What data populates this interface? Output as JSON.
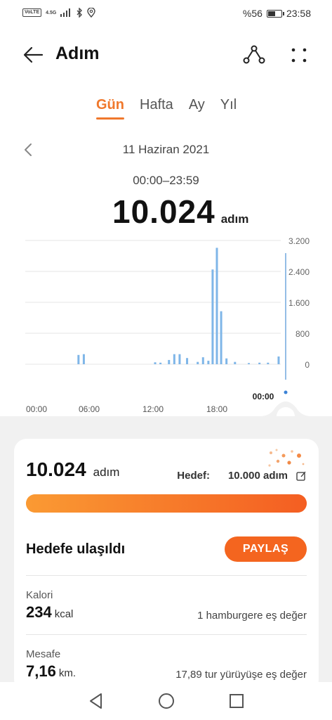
{
  "status_bar": {
    "volte": "VoLTE",
    "network": "4.5G",
    "battery": "%56",
    "battery_level": 0.56,
    "time": "23:58"
  },
  "app_bar": {
    "title": "Adım",
    "back_icon": "arrow-left-icon",
    "route_icon": "route-share-icon",
    "more_icon": "more-dots-icon"
  },
  "tabs": [
    {
      "label": "Gün",
      "active": true
    },
    {
      "label": "Hafta",
      "active": false
    },
    {
      "label": "Ay",
      "active": false
    },
    {
      "label": "Yıl",
      "active": false
    }
  ],
  "date": "11 Haziran 2021",
  "time_range": "00:00–23:59",
  "total_steps": "10.024",
  "steps_unit": "adım",
  "chart_data": {
    "type": "bar",
    "x_ticks": [
      "00:00",
      "06:00",
      "12:00",
      "18:00"
    ],
    "y_ticks": [
      "3.200",
      "2.400",
      "1.600",
      "800",
      "0"
    ],
    "ylim": [
      0,
      3200
    ],
    "cursor_label": "00:00",
    "bars": [
      {
        "hour": 5.0,
        "value": 240
      },
      {
        "hour": 5.5,
        "value": 260
      },
      {
        "hour": 12.2,
        "value": 50
      },
      {
        "hour": 12.7,
        "value": 40
      },
      {
        "hour": 13.5,
        "value": 110
      },
      {
        "hour": 14.0,
        "value": 260
      },
      {
        "hour": 14.5,
        "value": 260
      },
      {
        "hour": 15.2,
        "value": 160
      },
      {
        "hour": 16.2,
        "value": 60
      },
      {
        "hour": 16.7,
        "value": 180
      },
      {
        "hour": 17.2,
        "value": 90
      },
      {
        "hour": 17.6,
        "value": 2450
      },
      {
        "hour": 18.0,
        "value": 3010
      },
      {
        "hour": 18.4,
        "value": 1370
      },
      {
        "hour": 18.9,
        "value": 150
      },
      {
        "hour": 19.7,
        "value": 60
      },
      {
        "hour": 21.0,
        "value": 30
      },
      {
        "hour": 22.0,
        "value": 40
      },
      {
        "hour": 22.8,
        "value": 40
      },
      {
        "hour": 23.8,
        "value": 200
      }
    ]
  },
  "summary": {
    "steps": "10.024",
    "steps_unit": "adım",
    "goal_label": "Hedef:",
    "goal_value": "10.000 adım",
    "progress": 1.0,
    "goal_reached": "Hedefe ulaşıldı",
    "share_label": "PAYLAŞ"
  },
  "stats": [
    {
      "label": "Kalori",
      "value": "234",
      "unit": "kcal",
      "equivalent": "1 hamburgere eş değer"
    },
    {
      "label": "Mesafe",
      "value": "7,16",
      "unit": "km.",
      "equivalent": "17,89 tur yürüyüşe eş değer"
    }
  ],
  "colors": {
    "accent": "#f0782c",
    "bar": "#7fb6e8",
    "share_button": "#f4651f"
  }
}
